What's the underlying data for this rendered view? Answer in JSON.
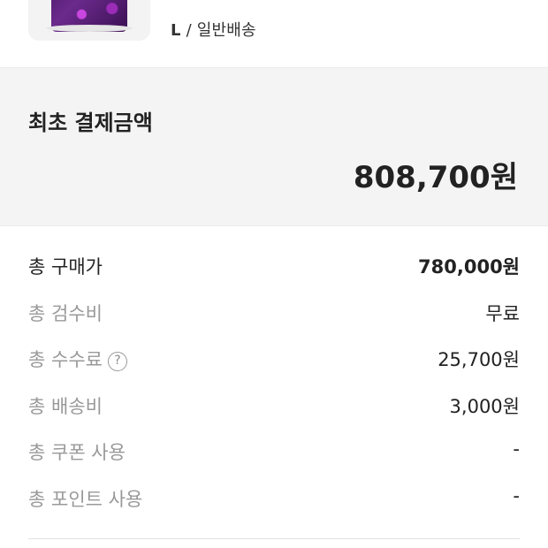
{
  "product": {
    "option_size": "L",
    "option_separator": " / ",
    "option_shipping": "일반배송"
  },
  "payment": {
    "title": "최초 결제금액",
    "amount": "808,700원"
  },
  "breakdown": {
    "rows": [
      {
        "label": "총 구매가",
        "value": "780,000원"
      },
      {
        "label": "총 검수비",
        "value": "무료"
      },
      {
        "label": "총 수수료",
        "value": "25,700원",
        "help_icon": "question-circle-icon"
      },
      {
        "label": "총 배송비",
        "value": "3,000원"
      },
      {
        "label": "총 쿠폰 사용",
        "value": "-"
      },
      {
        "label": "총 포인트 사용",
        "value": "-"
      }
    ]
  },
  "colors": {
    "text_primary": "#222222",
    "text_secondary": "#999999",
    "section_background": "#f4f4f4",
    "product_accent": "#6b2a8c"
  }
}
